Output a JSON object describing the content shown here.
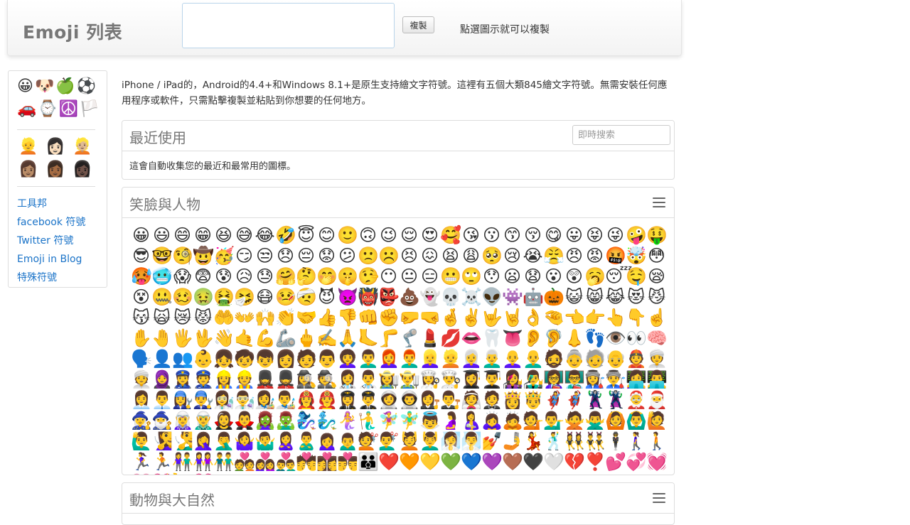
{
  "header": {
    "brand": "Emoji 列表",
    "copy_button": "複製",
    "hint": "點選圖示就可以複製"
  },
  "sidebar": {
    "categories": [
      "😀",
      "🐶",
      "🍏",
      "⚽",
      "🚗",
      "⌚",
      "☮️",
      "🏳️"
    ],
    "skin_tones": [
      "👱",
      "👩🏻",
      "👱🏼",
      "👩🏽",
      "👩🏾",
      "👩🏿"
    ],
    "links": [
      "工具邦",
      "facebook 符號",
      "Twitter 符號",
      "Emoji in Blog",
      "特殊符號"
    ]
  },
  "main": {
    "intro": "iPhone / iPad的，Android的4.4+和Windows 8.1+是原生支持繪文字符號。這裡有五個大類845繪文字符號。無需安裝任何應用程序或軟件，只需點擊複製並粘貼到你想要的任何地方。",
    "recent": {
      "title": "最近使用",
      "search_placeholder": "即時搜索",
      "description": "這會自動收集您的最近和最常用的圖標。"
    },
    "smileys": {
      "title": "笑臉與人物",
      "emojis": "😀😃😄😁😆😅😂🤣😇😊🙂🙃😉😌😍🥰😘😗😙😚😋😛😝😜🤪🤑😎🤓🧐🤠🥳😏😒😞😔😟😕🙁☹️😣😖😫😩🥺😢😭😤😠😡🤬🤯😳🥵🥶😱😨😰😥😓🤗🤔🤭🤫🤥😶😐😑😬🙄😯😦😧😮😲🥱😴🤤😪😵🤐🥴🤢🤮🤧😷🤒🤕😈👿👹👺💩👻💀☠️👽👾🤖🎃😺😸😹😻😼😽🙀😿😾🤲👐🙌👏🤝👍👎👊✊🤛🤜🤞✌️🤟🤘👌🤏👈👉👆👇☝️✋🤚🖐️🖖👋🤙💪🦾🖕✍️🙏🦶🦵🦿💄💋👄🦷👅👂🦻👃👣👁️👀🧠🗣️👤👥👶👧🧒👦👩🧑👨👩‍🦱👨‍🦱👩‍🦰👨‍🦰👱‍♀️👱👩‍🦳👨‍🦳👩‍🦲👨‍🦲🧔👵🧓👴👲👳‍♀️👳🧕👮‍♀️👮👷‍♀️👷💂‍♀️💂🕵️‍♀️🕵️👩‍⚕️👨‍⚕️👩‍🌾👨‍🌾👩‍🍳👨‍🍳👩‍🎓👨‍🎓👩‍🎤👨‍🎤👩‍🏫👨‍🏫👩‍🏭👨‍🏭👩‍💻👨‍💻👩‍💼👨‍💼👩‍🔧👨‍🔧👩‍🔬👨‍🔬👩‍🎨👨‍🎨👩‍🚒👨‍🚒👩‍✈️👨‍✈️👩‍🚀👨‍🚀👩‍⚖️👨‍⚖️👰🤵👸🤴🦸‍♀️🦸‍♂️🦹‍♀️🦹‍♂️🤶🎅🧙‍♀️🧙‍♂️🧝‍♀️🧝‍♂️🧛‍♀️🧛‍♂️🧟‍♀️🧟‍♂️🧞‍♀️🧞‍♂️🧜‍♀️🧜‍♂️🧚‍♀️🧚‍♂️👼🤰🤱🙇‍♀️🙇💁💁‍♂️🙅🙅‍♂️🙆🙆‍♂️🙋🙋‍♂️🧏‍♀️🧏‍♂️🤦‍♀️🤦‍♂️🤷‍♀️🤷‍♂️🙎‍♀️🙎‍♂️🙍‍♀️🙍‍♂️💇💇‍♂️💆💆‍♂️🧖‍♀️🧖‍♂️💅🤳💃🕺👯‍♀️👯‍♂️🕴️🚶‍♀️🚶🏃‍♀️🏃👫👭👬💑👩‍❤️‍👩👨‍❤️‍👨💏👩‍❤️‍💋‍👩👨‍❤️‍💋‍👨👪❤️🧡💛💚💙💜🤎🖤🤍💔❣️💕💞💓💗💖💘💝"
    },
    "animals": {
      "title": "動物與大自然"
    }
  }
}
